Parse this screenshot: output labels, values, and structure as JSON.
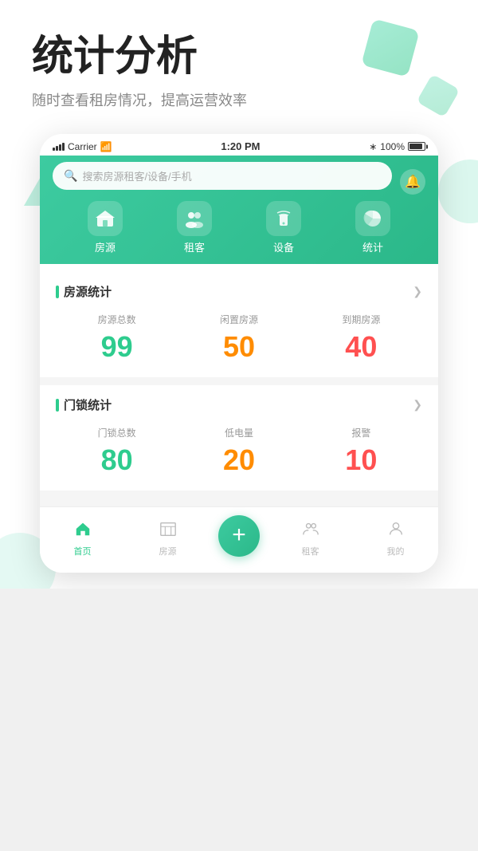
{
  "hero": {
    "title": "统计分析",
    "subtitle": "随时查看租房情况，提高运营效率"
  },
  "statusBar": {
    "carrier": "Carrier",
    "wifi": "wifi",
    "time": "1:20 PM",
    "bluetooth": "bluetooth",
    "battery": "100%"
  },
  "searchBar": {
    "placeholder": "搜索房源租客/设备/手机"
  },
  "navIcons": [
    {
      "id": "house",
      "label": "房源",
      "icon": "🏢"
    },
    {
      "id": "tenant",
      "label": "租客",
      "icon": "👥"
    },
    {
      "id": "device",
      "label": "设备",
      "icon": "📡"
    },
    {
      "id": "stats",
      "label": "统计",
      "icon": "📊"
    }
  ],
  "roomStats": {
    "title": "房源统计",
    "items": [
      {
        "label": "房源总数",
        "value": "99",
        "colorClass": "green"
      },
      {
        "label": "闲置房源",
        "value": "50",
        "colorClass": "orange"
      },
      {
        "label": "到期房源",
        "value": "40",
        "colorClass": "red"
      }
    ]
  },
  "lockStats": {
    "title": "门锁统计",
    "items": [
      {
        "label": "门锁总数",
        "value": "80",
        "colorClass": "green"
      },
      {
        "label": "低电量",
        "value": "20",
        "colorClass": "orange"
      },
      {
        "label": "报警",
        "value": "10",
        "colorClass": "red"
      }
    ]
  },
  "bottomNav": [
    {
      "id": "home",
      "label": "首页",
      "icon": "⌂",
      "active": true
    },
    {
      "id": "property",
      "label": "房源",
      "icon": "🏢",
      "active": false
    },
    {
      "id": "add",
      "label": "",
      "icon": "+",
      "isAdd": true
    },
    {
      "id": "tenant",
      "label": "租客",
      "icon": "👤",
      "active": false
    },
    {
      "id": "mine",
      "label": "我的",
      "icon": "👤",
      "active": false
    }
  ]
}
